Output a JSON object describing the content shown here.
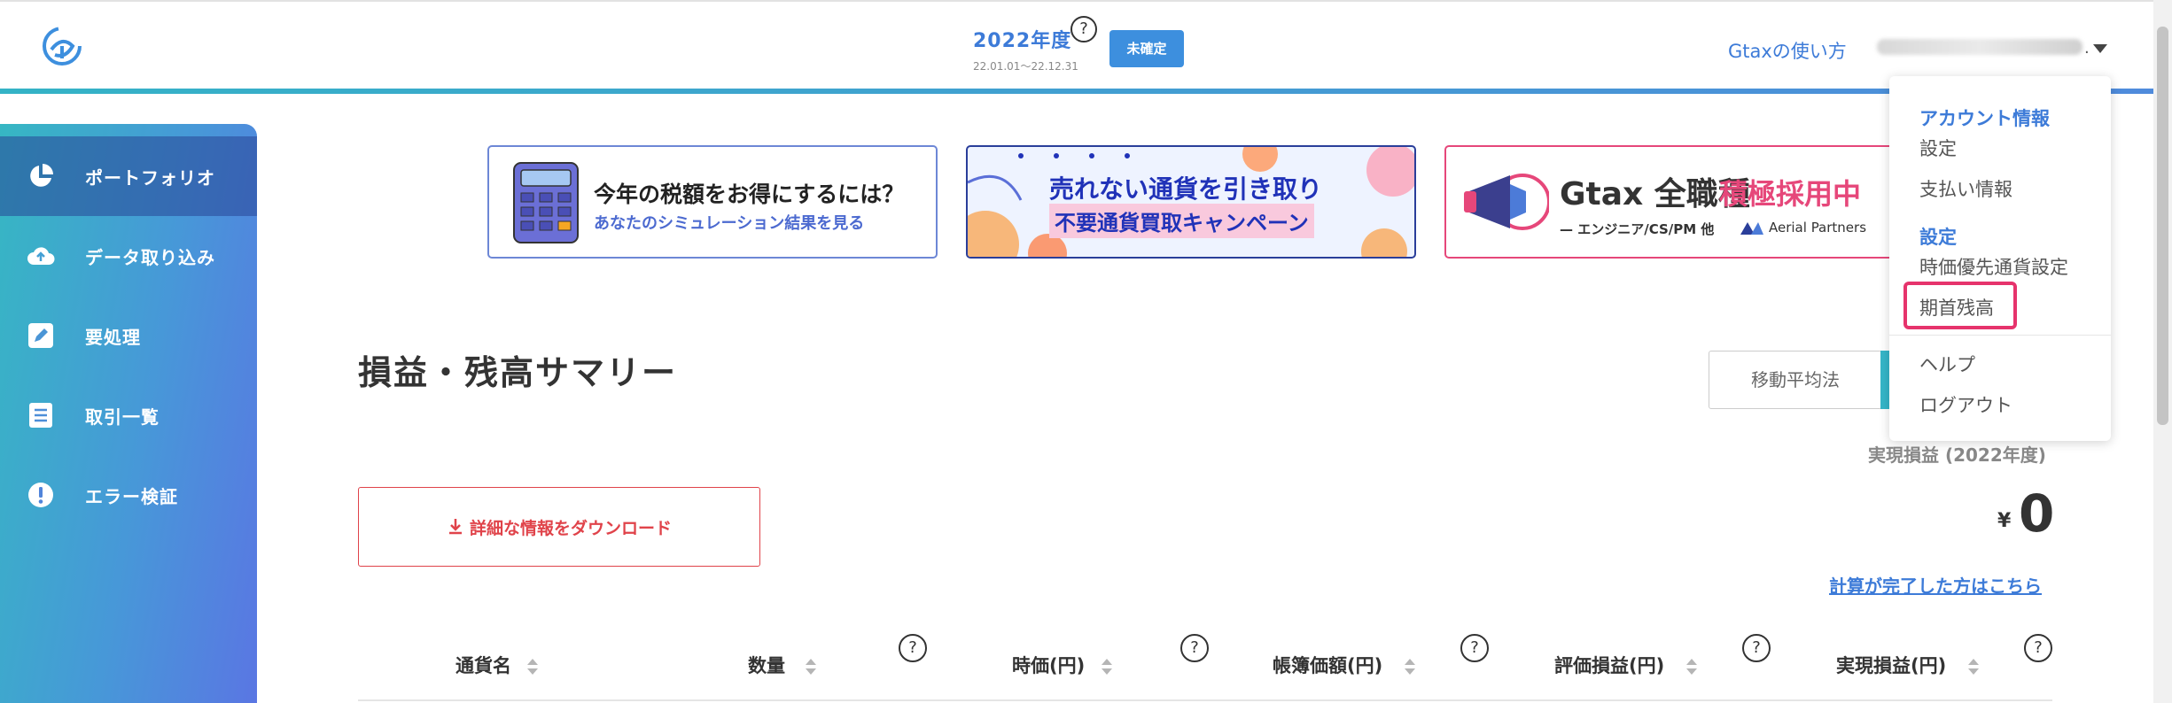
{
  "header": {
    "fiscal_year": "2022年度",
    "fiscal_range": "22.01.01〜22.12.31",
    "help_glyph": "?",
    "status_badge": "未確定",
    "howto_link": "Gtaxの使い方",
    "user_suffix": "."
  },
  "sidebar": {
    "items": [
      {
        "label": "ポートフォリオ",
        "icon": "pie-chart-icon",
        "active": true
      },
      {
        "label": "データ取り込み",
        "icon": "cloud-upload-icon",
        "active": false
      },
      {
        "label": "要処理",
        "icon": "edit-icon",
        "active": false
      },
      {
        "label": "取引一覧",
        "icon": "list-icon",
        "active": false
      },
      {
        "label": "エラー検証",
        "icon": "alert-icon",
        "active": false
      }
    ]
  },
  "banners": [
    {
      "title": "今年の税額をお得にするには？",
      "subtitle": "あなたのシミュレーション結果を見る"
    },
    {
      "title": "売れない通貨を引き取り",
      "subtitle": "不要通貨買取キャンペーン"
    },
    {
      "brand": "Gtax 全職種",
      "hiring": "積極採用中",
      "subtitle": "— エンジニア/CS/PM 他",
      "partner": "Aerial Partners"
    }
  ],
  "main": {
    "title": "損益・残高サマリー",
    "method_button": "移動平均法",
    "profit_label": "実現損益 (2022年度)",
    "currency_symbol": "¥",
    "profit_value": "0",
    "calc_link": "計算が完了した方はこちら",
    "download_button": "詳細な情報をダウンロード"
  },
  "table": {
    "columns": [
      "通貨名",
      "数量",
      "時価(円)",
      "帳簿価額(円)",
      "評価損益(円)",
      "実現損益(円)"
    ]
  },
  "dropdown": {
    "account_header": "アカウント情報",
    "account_items": [
      "設定",
      "支払い情報"
    ],
    "settings_header": "設定",
    "settings_items": [
      "時価優先通貨設定",
      "期首残高"
    ],
    "other_items": [
      "ヘルプ",
      "ログアウト"
    ]
  },
  "colors": {
    "accent_blue": "#3d7bd8",
    "badge_blue": "#3d8fde",
    "download_red": "#e0434a",
    "highlight_pink": "#e6336c"
  }
}
